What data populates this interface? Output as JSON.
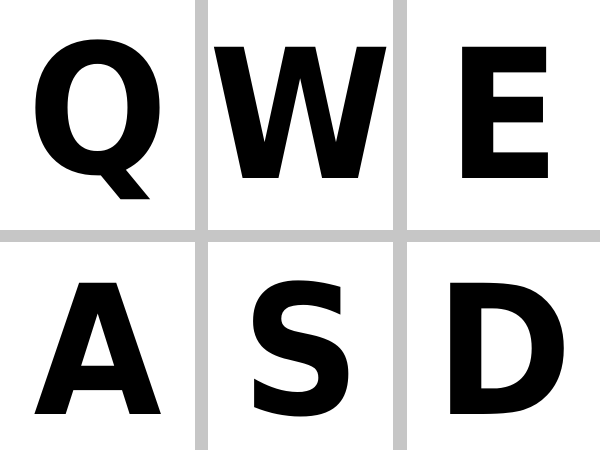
{
  "keypad": {
    "colors": {
      "background": "#ffffff",
      "divider": "#c6c6c6",
      "key_text": "#000000"
    },
    "rows": [
      {
        "keys": [
          {
            "label": "Q"
          },
          {
            "label": "W"
          },
          {
            "label": "E"
          }
        ]
      },
      {
        "keys": [
          {
            "label": "A"
          },
          {
            "label": "S"
          },
          {
            "label": "D"
          }
        ]
      }
    ]
  }
}
